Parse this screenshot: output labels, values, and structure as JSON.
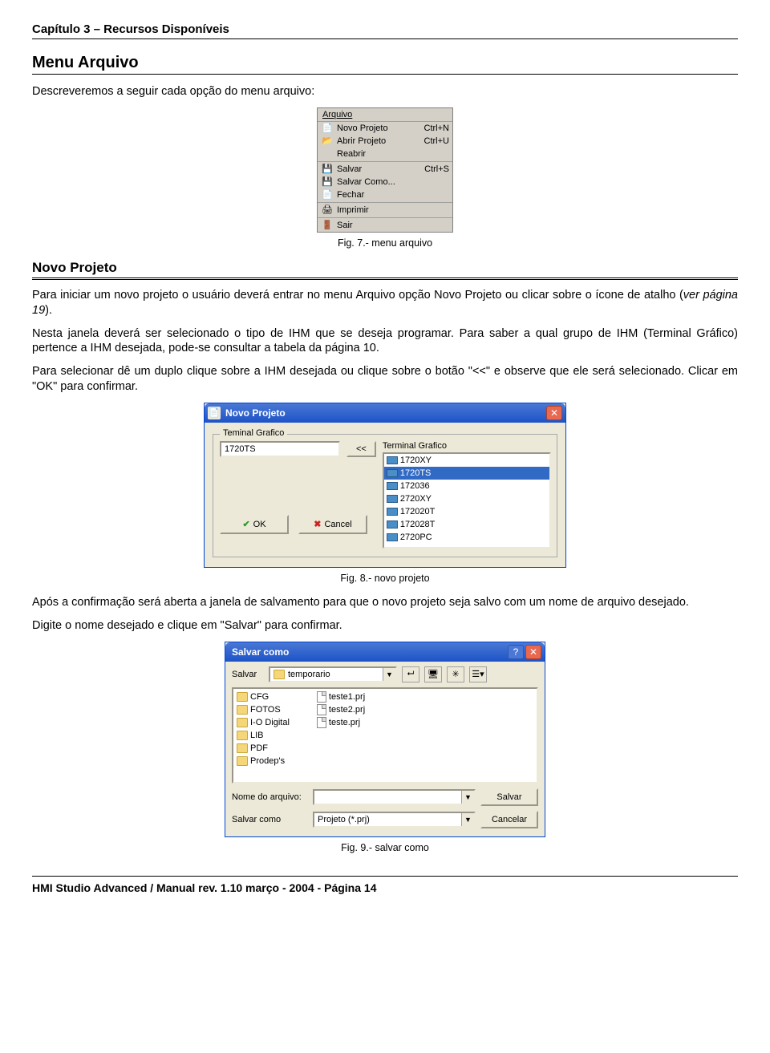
{
  "chapter": "Capítulo 3 – Recursos Disponíveis",
  "h1": "Menu Arquivo",
  "intro": "Descreveremos a seguir cada opção do menu arquivo:",
  "fig7": {
    "title": "Arquivo",
    "items": [
      {
        "label": "Novo Projeto",
        "shortcut": "Ctrl+N"
      },
      {
        "label": "Abrir Projeto",
        "shortcut": "Ctrl+U"
      },
      {
        "label": "Reabrir",
        "shortcut": ""
      },
      {
        "sep": true
      },
      {
        "label": "Salvar",
        "shortcut": "Ctrl+S"
      },
      {
        "label": "Salvar Como...",
        "shortcut": ""
      },
      {
        "label": "Fechar",
        "shortcut": ""
      },
      {
        "sep": true
      },
      {
        "label": "Imprimir",
        "shortcut": ""
      },
      {
        "sep": true
      },
      {
        "label": "Sair",
        "shortcut": ""
      }
    ],
    "caption": "Fig. 7.- menu arquivo"
  },
  "h2": "Novo Projeto",
  "para1a": "Para iniciar um novo projeto o usuário deverá entrar no menu Arquivo opção Novo Projeto ou clicar sobre o ícone de atalho (",
  "para1b": "ver página 19",
  "para1c": ").",
  "para2": "Nesta janela deverá ser selecionado o tipo de IHM que se deseja programar. Para saber a qual grupo de IHM (Terminal Gráfico) pertence a IHM desejada, pode-se consultar a tabela da página 10.",
  "para3": "Para selecionar dê um duplo clique sobre a IHM desejada ou clique sobre o botão \"<<\" e observe que ele será selecionado. Clicar em \"OK\" para confirmar.",
  "fig8": {
    "title": "Novo Projeto",
    "groupLabel": "Teminal Grafico",
    "selected": "1720TS",
    "moveBtn": "<<",
    "listLabel": "Terminal Grafico",
    "items": [
      "1720XY",
      "1720TS",
      "172036",
      "2720XY",
      "172020T",
      "172028T",
      "2720PC"
    ],
    "selIndex": 1,
    "ok": "OK",
    "cancel": "Cancel",
    "caption": "Fig. 8.- novo projeto"
  },
  "para4": "Após a confirmação será aberta a janela de salvamento para que o novo projeto seja salvo com um nome de arquivo desejado.",
  "para5": "Digite o nome desejado e clique em \"Salvar\" para confirmar.",
  "fig9": {
    "title": "Salvar como",
    "locLabel": "Salvar",
    "location": "temporario",
    "folders": [
      "CFG",
      "FOTOS",
      "I-O Digital",
      "LIB",
      "PDF",
      "Prodep's"
    ],
    "files": [
      "teste1.prj",
      "teste2.prj",
      "teste.prj"
    ],
    "nameLabel": "Nome do arquivo:",
    "nameValue": "",
    "typeLabel": "Salvar como",
    "typeValue": "Projeto (*.prj)",
    "save": "Salvar",
    "cancel": "Cancelar",
    "caption": "Fig. 9.- salvar como"
  },
  "footer": "HMI Studio Advanced / Manual rev. 1.10 março - 2004     -     Página 14"
}
